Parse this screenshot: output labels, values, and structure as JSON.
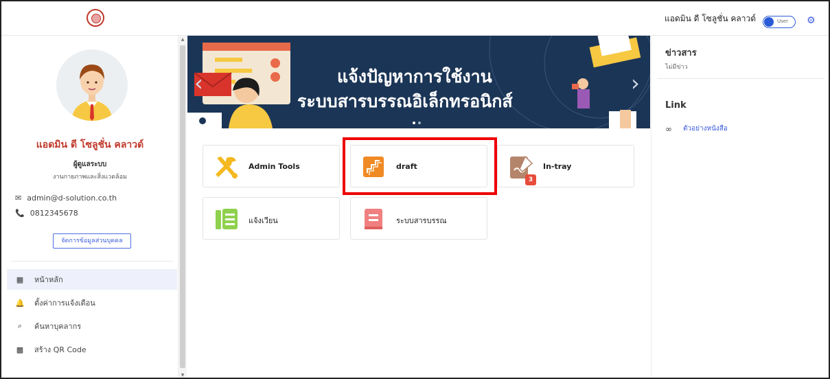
{
  "topbar": {
    "user_name": "แอดมิน ดี โซลูชั่น คลาวด์",
    "toggle_label": "User"
  },
  "profile": {
    "name": "แอดมิน ดี โซลูชั่น คลาวด์",
    "role": "ผู้ดูแลระบบ",
    "department": "งานกายภาพและสิ่งแวดล้อม",
    "email": "admin@d-solution.co.th",
    "phone": "0812345678",
    "manage_button": "จัดการข้อมูลส่วนบุคคล"
  },
  "nav": [
    {
      "label": "หน้าหลัก",
      "icon": "grid-icon"
    },
    {
      "label": "ตั้งค่าการแจ้งเตือน",
      "icon": "bell-icon"
    },
    {
      "label": "ค้นหาบุคลากร",
      "icon": "search-icon"
    },
    {
      "label": "สร้าง QR Code",
      "icon": "qr-icon"
    }
  ],
  "banner": {
    "line1": "แจ้งปัญหาการใช้งาน",
    "line2": "ระบบสารบรรณอิเล็กทรอนิกส์",
    "prev": "‹",
    "next": "›"
  },
  "cards": [
    {
      "label": "Admin Tools",
      "icon": "tools-icon"
    },
    {
      "label": "draft",
      "icon": "draft-icon"
    },
    {
      "label": "In-tray",
      "icon": "intray-icon",
      "badge": "3"
    },
    {
      "label": "แจ้งเวียน",
      "icon": "circular-icon"
    },
    {
      "label": "ระบบสารบรรณ",
      "icon": "book-icon"
    }
  ],
  "right": {
    "news_title": "ข่าวสาร",
    "news_empty": "ไม่มีข่าว",
    "link_title": "Link",
    "link_item": "ตัวอย่างหนังสือ"
  },
  "colors": {
    "accent": "#3b5bdb",
    "name_red": "#c0392b",
    "banner_bg": "#1b3556",
    "highlight": "#ee0000"
  }
}
